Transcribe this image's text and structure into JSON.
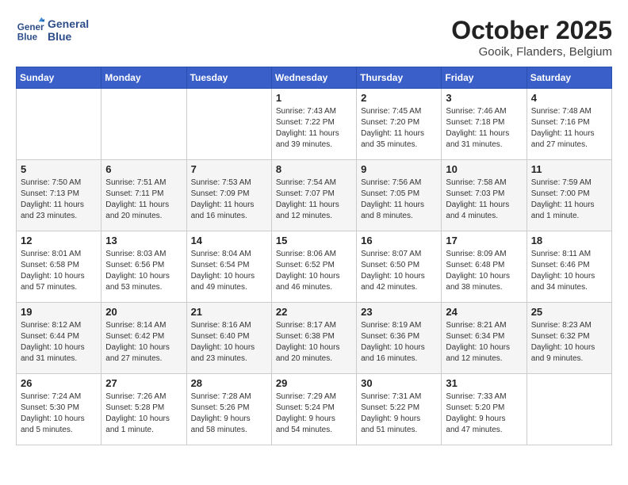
{
  "header": {
    "logo_line1": "General",
    "logo_line2": "Blue",
    "month_title": "October 2025",
    "subtitle": "Gooik, Flanders, Belgium"
  },
  "weekdays": [
    "Sunday",
    "Monday",
    "Tuesday",
    "Wednesday",
    "Thursday",
    "Friday",
    "Saturday"
  ],
  "weeks": [
    [
      {
        "day": "",
        "info": ""
      },
      {
        "day": "",
        "info": ""
      },
      {
        "day": "",
        "info": ""
      },
      {
        "day": "1",
        "info": "Sunrise: 7:43 AM\nSunset: 7:22 PM\nDaylight: 11 hours\nand 39 minutes."
      },
      {
        "day": "2",
        "info": "Sunrise: 7:45 AM\nSunset: 7:20 PM\nDaylight: 11 hours\nand 35 minutes."
      },
      {
        "day": "3",
        "info": "Sunrise: 7:46 AM\nSunset: 7:18 PM\nDaylight: 11 hours\nand 31 minutes."
      },
      {
        "day": "4",
        "info": "Sunrise: 7:48 AM\nSunset: 7:16 PM\nDaylight: 11 hours\nand 27 minutes."
      }
    ],
    [
      {
        "day": "5",
        "info": "Sunrise: 7:50 AM\nSunset: 7:13 PM\nDaylight: 11 hours\nand 23 minutes."
      },
      {
        "day": "6",
        "info": "Sunrise: 7:51 AM\nSunset: 7:11 PM\nDaylight: 11 hours\nand 20 minutes."
      },
      {
        "day": "7",
        "info": "Sunrise: 7:53 AM\nSunset: 7:09 PM\nDaylight: 11 hours\nand 16 minutes."
      },
      {
        "day": "8",
        "info": "Sunrise: 7:54 AM\nSunset: 7:07 PM\nDaylight: 11 hours\nand 12 minutes."
      },
      {
        "day": "9",
        "info": "Sunrise: 7:56 AM\nSunset: 7:05 PM\nDaylight: 11 hours\nand 8 minutes."
      },
      {
        "day": "10",
        "info": "Sunrise: 7:58 AM\nSunset: 7:03 PM\nDaylight: 11 hours\nand 4 minutes."
      },
      {
        "day": "11",
        "info": "Sunrise: 7:59 AM\nSunset: 7:00 PM\nDaylight: 11 hours\nand 1 minute."
      }
    ],
    [
      {
        "day": "12",
        "info": "Sunrise: 8:01 AM\nSunset: 6:58 PM\nDaylight: 10 hours\nand 57 minutes."
      },
      {
        "day": "13",
        "info": "Sunrise: 8:03 AM\nSunset: 6:56 PM\nDaylight: 10 hours\nand 53 minutes."
      },
      {
        "day": "14",
        "info": "Sunrise: 8:04 AM\nSunset: 6:54 PM\nDaylight: 10 hours\nand 49 minutes."
      },
      {
        "day": "15",
        "info": "Sunrise: 8:06 AM\nSunset: 6:52 PM\nDaylight: 10 hours\nand 46 minutes."
      },
      {
        "day": "16",
        "info": "Sunrise: 8:07 AM\nSunset: 6:50 PM\nDaylight: 10 hours\nand 42 minutes."
      },
      {
        "day": "17",
        "info": "Sunrise: 8:09 AM\nSunset: 6:48 PM\nDaylight: 10 hours\nand 38 minutes."
      },
      {
        "day": "18",
        "info": "Sunrise: 8:11 AM\nSunset: 6:46 PM\nDaylight: 10 hours\nand 34 minutes."
      }
    ],
    [
      {
        "day": "19",
        "info": "Sunrise: 8:12 AM\nSunset: 6:44 PM\nDaylight: 10 hours\nand 31 minutes."
      },
      {
        "day": "20",
        "info": "Sunrise: 8:14 AM\nSunset: 6:42 PM\nDaylight: 10 hours\nand 27 minutes."
      },
      {
        "day": "21",
        "info": "Sunrise: 8:16 AM\nSunset: 6:40 PM\nDaylight: 10 hours\nand 23 minutes."
      },
      {
        "day": "22",
        "info": "Sunrise: 8:17 AM\nSunset: 6:38 PM\nDaylight: 10 hours\nand 20 minutes."
      },
      {
        "day": "23",
        "info": "Sunrise: 8:19 AM\nSunset: 6:36 PM\nDaylight: 10 hours\nand 16 minutes."
      },
      {
        "day": "24",
        "info": "Sunrise: 8:21 AM\nSunset: 6:34 PM\nDaylight: 10 hours\nand 12 minutes."
      },
      {
        "day": "25",
        "info": "Sunrise: 8:23 AM\nSunset: 6:32 PM\nDaylight: 10 hours\nand 9 minutes."
      }
    ],
    [
      {
        "day": "26",
        "info": "Sunrise: 7:24 AM\nSunset: 5:30 PM\nDaylight: 10 hours\nand 5 minutes."
      },
      {
        "day": "27",
        "info": "Sunrise: 7:26 AM\nSunset: 5:28 PM\nDaylight: 10 hours\nand 1 minute."
      },
      {
        "day": "28",
        "info": "Sunrise: 7:28 AM\nSunset: 5:26 PM\nDaylight: 9 hours\nand 58 minutes."
      },
      {
        "day": "29",
        "info": "Sunrise: 7:29 AM\nSunset: 5:24 PM\nDaylight: 9 hours\nand 54 minutes."
      },
      {
        "day": "30",
        "info": "Sunrise: 7:31 AM\nSunset: 5:22 PM\nDaylight: 9 hours\nand 51 minutes."
      },
      {
        "day": "31",
        "info": "Sunrise: 7:33 AM\nSunset: 5:20 PM\nDaylight: 9 hours\nand 47 minutes."
      },
      {
        "day": "",
        "info": ""
      }
    ]
  ]
}
